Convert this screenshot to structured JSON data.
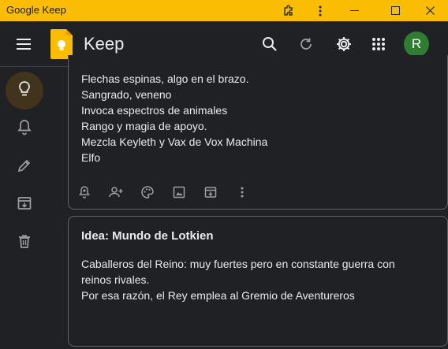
{
  "window": {
    "title": "Google Keep"
  },
  "appbar": {
    "app_name": "Keep",
    "avatar_initial": "R"
  },
  "notes": [
    {
      "lines": [
        "Flechas espinas, algo en el brazo.",
        "Sangrado, veneno",
        "Invoca espectros de animales",
        "Rango y magia de apoyo.",
        "Mezcla Keyleth y Vax de Vox Machina",
        "Elfo"
      ]
    },
    {
      "title": "Idea: Mundo de Lotkien",
      "lines": [
        "Caballeros del Reino: muy fuertes pero en constante guerra con",
        "reinos rivales.",
        "Por esa razón, el Rey emplea al Gremio de Aventureros"
      ]
    }
  ],
  "colors": {
    "titlebar": "#fbbc04",
    "background": "#202124",
    "active_nav": "#41331c",
    "avatar": "#2f7d32"
  }
}
